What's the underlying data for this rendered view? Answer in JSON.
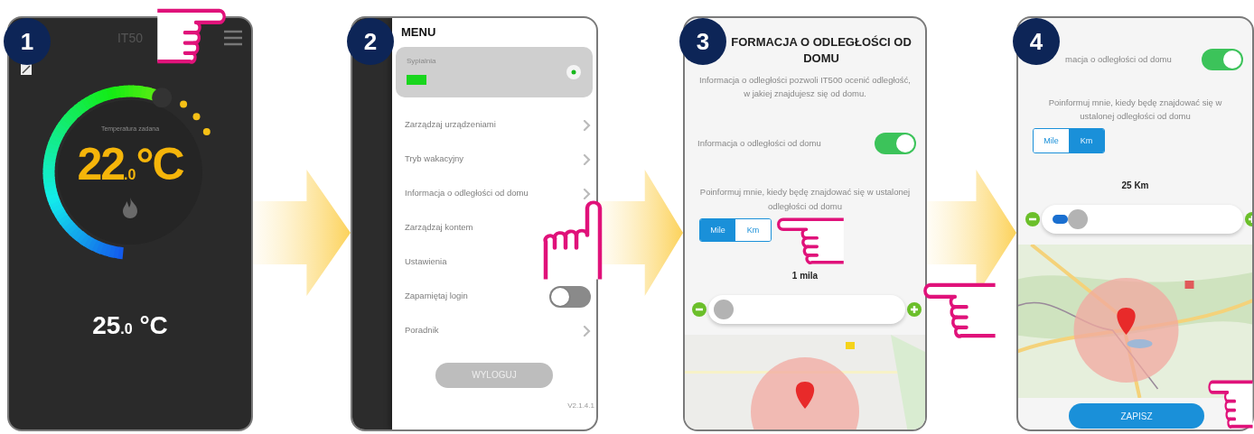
{
  "steps": [
    {
      "number": "1",
      "kind": "thermostat",
      "app_title": "IT50",
      "setpoint_label": "Temperatura zadana",
      "setpoint": "22$_{.0}$°C",
      "current": "25$_{.0}$ °C"
    },
    {
      "number": "2",
      "kind": "menu",
      "heading": "MENU",
      "device": {
        "name": "Sypialnia",
        "selected": true
      },
      "items": [
        {
          "kind": "link",
          "label": "Zarządzaj urządzeniami"
        },
        {
          "kind": "link",
          "label": "Tryb wakacyjny"
        },
        {
          "kind": "link",
          "label": "Informacja o odległości od domu"
        },
        {
          "kind": "plain",
          "label": "Zarządzaj kontem"
        },
        {
          "kind": "plain",
          "label": "Ustawienia"
        },
        {
          "kind": "toggle",
          "label": "Zapamiętaj login",
          "on": false
        },
        {
          "kind": "link",
          "label": "Poradnik"
        }
      ],
      "logout": "WYLOGUJ",
      "version": "V2.1.4.1"
    },
    {
      "number": "3",
      "kind": "distance",
      "title": "FORMACJA O ODLEGŁOŚCI OD DOMU",
      "description": "Informacja o odległości pozwoli IT500 ocenić odległość, w jakiej znajdujesz się od domu.",
      "toggle": {
        "label": "Informacja o odległości od domu",
        "on": true
      },
      "prompt": "Poinformuj mnie, kiedy będę znajdować się w ustalonej odległości od domu",
      "units": [
        {
          "label": "Mile",
          "selected": true
        },
        {
          "label": "Km",
          "selected": false
        }
      ],
      "distance": "1 mila",
      "slider": {
        "level": 0
      }
    },
    {
      "number": "4",
      "kind": "distance",
      "toggle": {
        "label": "macja o odległości od domu",
        "on": true
      },
      "prompt": "Poinformuj mnie, kiedy będę znajdować się w ustalonej odległości od domu",
      "units": [
        {
          "label": "Mile",
          "selected": false
        },
        {
          "label": "Km",
          "selected": true
        }
      ],
      "distance": "25 Km",
      "slider": {
        "level": 0.12
      },
      "save": "ZAPISZ"
    }
  ]
}
